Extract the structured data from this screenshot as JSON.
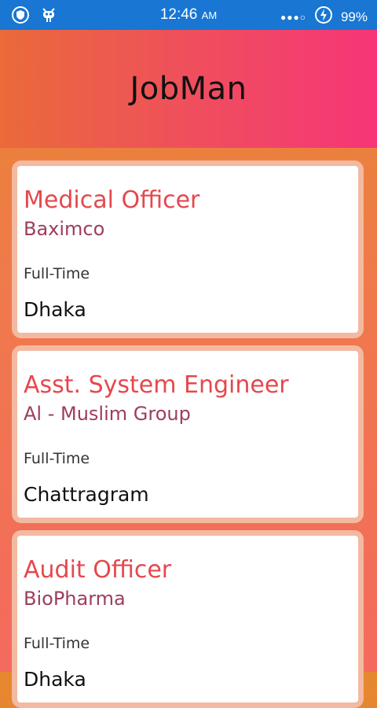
{
  "status_bar": {
    "time": "12:46",
    "ampm": "AM",
    "battery": "99%"
  },
  "header": {
    "title": "JobMan"
  },
  "jobs": [
    {
      "title": "Medical Officer",
      "company": "Baximco",
      "type": "Full-Time",
      "location": "Dhaka"
    },
    {
      "title": "Asst. System Engineer",
      "company": "Al - Muslim Group",
      "type": "Full-Time",
      "location": "Chattragram"
    },
    {
      "title": "Audit Officer",
      "company": "BioPharma",
      "type": "Full-Time",
      "location": "Dhaka"
    }
  ],
  "colors": {
    "status_bar": "#1976d2",
    "job_title": "#e5484d",
    "company": "#9c3e5c"
  }
}
